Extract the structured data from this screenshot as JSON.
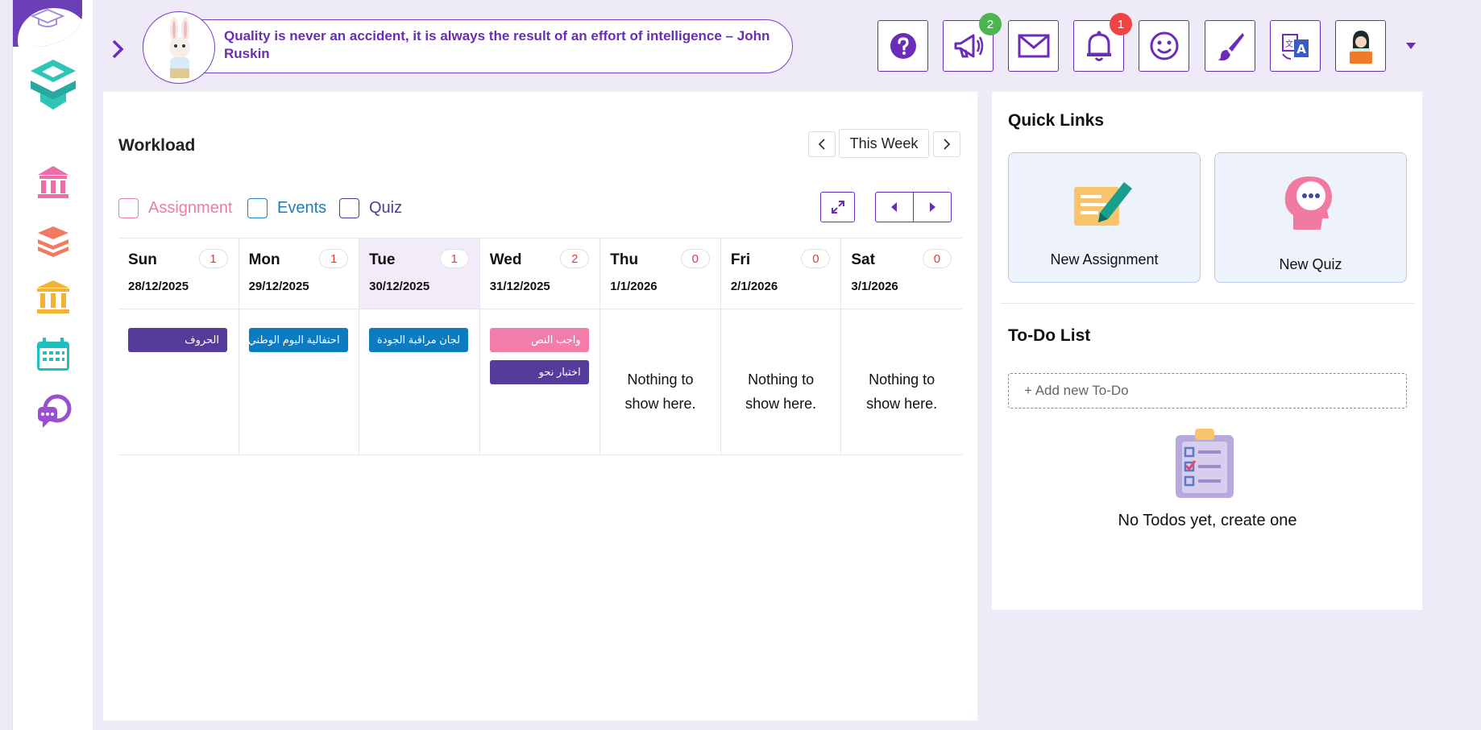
{
  "sidebar": {
    "items": [
      {
        "name": "school-icon",
        "color": "#ec6ea6"
      },
      {
        "name": "books-icon",
        "color": "#f07a62"
      },
      {
        "name": "institution-icon",
        "color": "#f2b233"
      },
      {
        "name": "calendar-icon",
        "color": "#1fbfbf"
      },
      {
        "name": "chat-icon",
        "color": "#9a4fd0"
      }
    ]
  },
  "header": {
    "quote": "Quality is never an accident, it is always the result of an effort of intelligence – John Ruskin",
    "buttons": [
      {
        "name": "help-icon",
        "badge": ""
      },
      {
        "name": "megaphone-icon",
        "badge": "2",
        "badge_color": "#4cb552"
      },
      {
        "name": "mail-icon",
        "badge": ""
      },
      {
        "name": "bell-icon",
        "badge": "1",
        "badge_color": "#ef4444"
      },
      {
        "name": "smiley-icon",
        "badge": ""
      },
      {
        "name": "paintbrush-icon",
        "badge": ""
      },
      {
        "name": "translate-icon",
        "badge": ""
      },
      {
        "name": "profile-avatar-icon",
        "badge": ""
      }
    ]
  },
  "workload": {
    "title": "Workload",
    "week_label": "This Week",
    "filters": [
      {
        "label": "Assignment",
        "color": "#f07aa8"
      },
      {
        "label": "Events",
        "color": "#1a7fbf"
      },
      {
        "label": "Quiz",
        "color": "#4f3b9c"
      }
    ],
    "days": [
      {
        "name": "Sun",
        "date": "28/12/2025",
        "count": "1",
        "events": [
          {
            "label": "الحروف",
            "color": "#553c9a"
          }
        ]
      },
      {
        "name": "Mon",
        "date": "29/12/2025",
        "count": "1",
        "events": [
          {
            "label": "احتفالية اليوم الوطني",
            "color": "#0d7bbf"
          }
        ]
      },
      {
        "name": "Tue",
        "date": "30/12/2025",
        "count": "1",
        "today": true,
        "events": [
          {
            "label": "لجان مراقبة الجودة",
            "color": "#0d7bbf"
          }
        ]
      },
      {
        "name": "Wed",
        "date": "31/12/2025",
        "count": "2",
        "events": [
          {
            "label": "واجب النص",
            "color": "#f27dab"
          },
          {
            "label": "اختبار نحو",
            "color": "#553c9a"
          }
        ]
      },
      {
        "name": "Thu",
        "date": "1/1/2026",
        "count": "0",
        "events": []
      },
      {
        "name": "Fri",
        "date": "2/1/2026",
        "count": "0",
        "events": []
      },
      {
        "name": "Sat",
        "date": "3/1/2026",
        "count": "0",
        "events": []
      }
    ],
    "empty_line1": "Nothing to",
    "empty_line2": "show here."
  },
  "quick_links": {
    "title": "Quick Links",
    "items": [
      {
        "label": "New Assignment",
        "icon": "assignment-pen-icon"
      },
      {
        "label": "New Quiz",
        "icon": "quiz-head-icon"
      }
    ]
  },
  "todo": {
    "title": "To-Do List",
    "placeholder": "+ Add new To-Do",
    "empty_text": "No Todos yet, create one"
  }
}
